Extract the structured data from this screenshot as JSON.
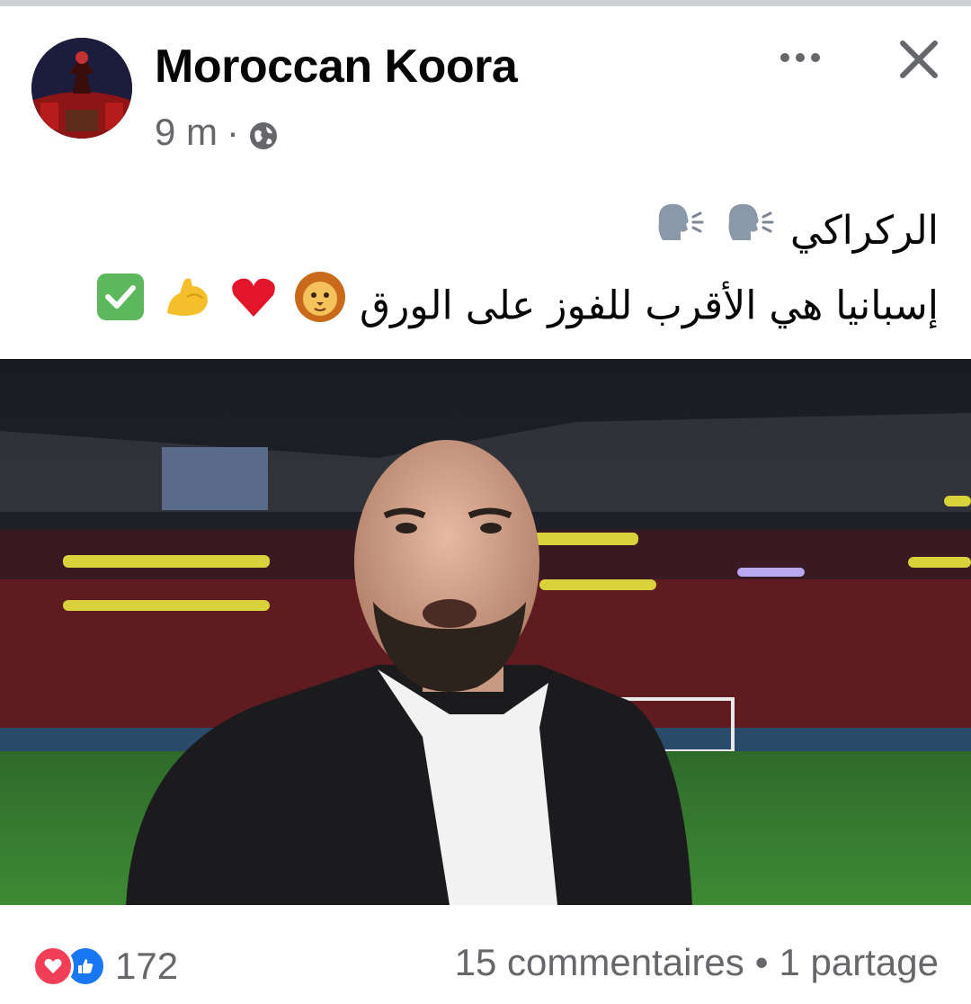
{
  "post": {
    "page_name": "Moroccan Koora",
    "time": "9 m",
    "separator": "·",
    "visibility_icon": "globe-icon",
    "text_line_1": "الركراكي",
    "text_line_1_emojis": [
      "speaking-head",
      "speaking-head"
    ],
    "text_line_2": "إسبانيا هي الأقرب للفوز على الورق",
    "text_line_2_emojis": [
      "lion-face",
      "red-heart",
      "flexed-biceps",
      "check-mark-button"
    ]
  },
  "footer": {
    "reaction_icons": [
      "love-icon",
      "like-icon"
    ],
    "reaction_count": "172",
    "comments": "15 commentaires",
    "dot": "•",
    "shares": "1 partage"
  },
  "colors": {
    "secondary_text": "#65676b",
    "love": "#f33e58",
    "like": "#1877f2",
    "divider": "#ced0d4"
  }
}
